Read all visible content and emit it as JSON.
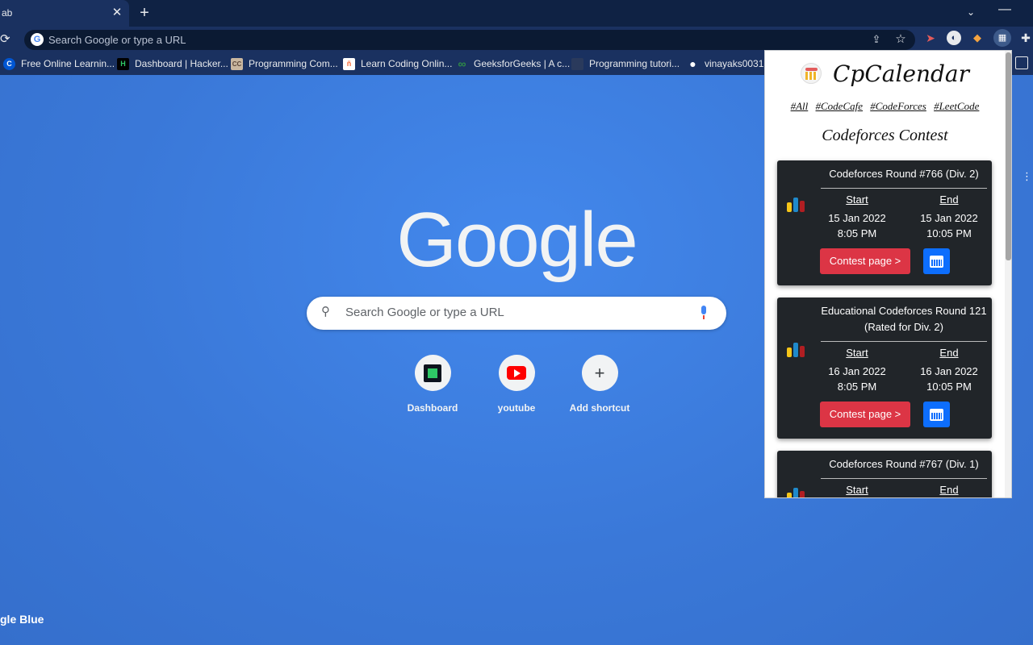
{
  "browser": {
    "tab_title": "ab",
    "close_glyph": "✕",
    "new_tab_glyph": "+",
    "tab_search_glyph": "⌄",
    "minimize_glyph": "—",
    "omnibox_placeholder": "Search Google or type a URL"
  },
  "bookmarks": [
    {
      "label": "Free Online Learnin...",
      "icon": "coursera-icon",
      "glyph": "C",
      "bg": "#0056d2",
      "color": "#ffffff"
    },
    {
      "label": "Dashboard | Hacker...",
      "icon": "hackerrank-icon",
      "glyph": "H",
      "bg": "#000000",
      "color": "#2ec866"
    },
    {
      "label": "Programming Com...",
      "icon": "codechef-icon",
      "glyph": "CC",
      "bg": "#c9b7a0",
      "color": "#5b4638"
    },
    {
      "label": "Learn Coding Onlin...",
      "icon": "codingninjas-icon",
      "glyph": "ñ",
      "bg": "#ffffff",
      "color": "#f66c3b"
    },
    {
      "label": "GeeksforGeeks | A c...",
      "icon": "gfg-icon",
      "glyph": "∞",
      "bg": "transparent",
      "color": "#2f8d46"
    },
    {
      "label": "Programming tutori...",
      "icon": "w3-icon",
      "glyph": "",
      "bg": "#2a3a5c",
      "color": "#ffffff"
    },
    {
      "label": "vinayaks0031",
      "icon": "github-icon",
      "glyph": "●",
      "bg": "transparent",
      "color": "#ffffff"
    }
  ],
  "ntp": {
    "logo_text": "Google",
    "search_placeholder": "Search Google or type a URL",
    "shortcuts": [
      {
        "label": "Dashboard",
        "icon": "hackerrank-icon"
      },
      {
        "label": "youtube",
        "icon": "youtube-icon"
      },
      {
        "label": "Add shortcut",
        "icon": "plus-icon",
        "glyph": "+"
      }
    ],
    "theme_label": "gle Blue"
  },
  "popup": {
    "brand_name": "CpCalendar",
    "filters": [
      "#All",
      "#CodeCafe",
      "#CodeForces",
      "#LeetCode"
    ],
    "section_title": "Codeforces Contest",
    "start_label": "Start",
    "end_label": "End",
    "contest_button_label": "Contest page >",
    "contests": [
      {
        "name_lines": [
          "Codeforces Round #766 (Div. 2)"
        ],
        "start_date": "15 Jan 2022",
        "start_time": "8:05 PM",
        "end_date": "15 Jan 2022",
        "end_time": "10:05 PM"
      },
      {
        "name_lines": [
          "Educational Codeforces Round 121",
          "(Rated for Div. 2)"
        ],
        "start_date": "16 Jan 2022",
        "start_time": "8:05 PM",
        "end_date": "16 Jan 2022",
        "end_time": "10:05 PM"
      },
      {
        "name_lines": [
          "Codeforces Round #767 (Div. 1)"
        ]
      }
    ]
  }
}
